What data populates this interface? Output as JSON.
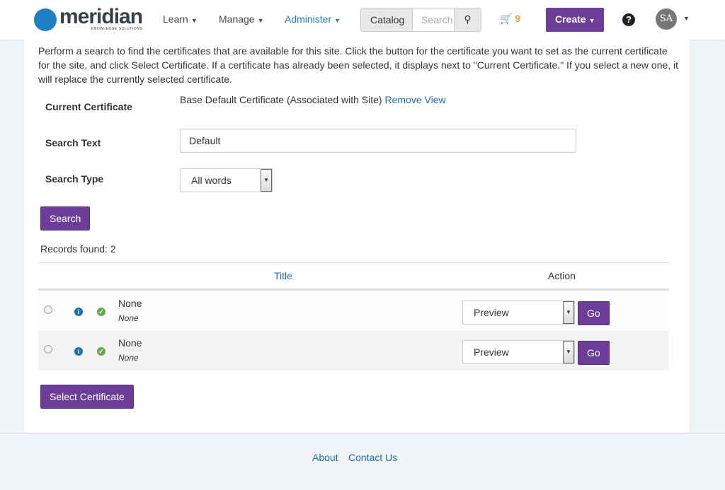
{
  "nav": {
    "logo_text": "meridian",
    "logo_sub": "KNOWLEDGE SOLUTIONS",
    "learn": "Learn",
    "manage": "Manage",
    "administer": "Administer",
    "catalog": "Catalog",
    "search_placeholder": "Search",
    "cart_count": "9",
    "create": "Create",
    "help": "?",
    "avatar": "SA"
  },
  "main": {
    "intro": "Perform a search to find the certificates that are available for this site. Click the button for the certificate you want to set as the current certificate for the site, and click Select Certificate. If a certificate has already been selected, it displays next to \"Current Certificate.\" If you select a new one, it will replace the currently selected certificate.",
    "current_label": "Current Certificate",
    "current_value": "Base Default Certificate (Associated with Site)",
    "remove": "Remove",
    "view": "View",
    "search_text_label": "Search Text",
    "search_text_value": "Default",
    "search_type_label": "Search Type",
    "search_type_value": "All words",
    "search_button": "Search",
    "records": "Records found: 2",
    "col_title": "Title",
    "col_action": "Action",
    "rows": [
      {
        "title": "None",
        "subtitle": "None",
        "action": "Preview",
        "go": "Go"
      },
      {
        "title": "None",
        "subtitle": "None",
        "action": "Preview",
        "go": "Go"
      }
    ],
    "select_button": "Select Certificate"
  },
  "footer": {
    "about": "About",
    "contact": "Contact Us"
  }
}
